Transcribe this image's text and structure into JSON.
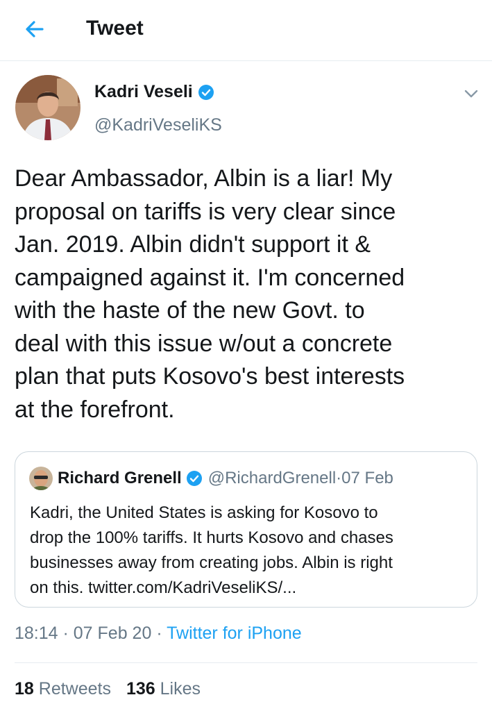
{
  "header": {
    "title": "Tweet",
    "back_icon": "arrow-left-icon",
    "accent": "#1da1f2"
  },
  "author": {
    "name": "Kadri Veseli",
    "handle": "@KadriVeseliKS",
    "verified": true
  },
  "tweet": {
    "lines": [
      "Dear Ambassador, Albin is a liar! My",
      "proposal on tariffs is very clear since",
      "Jan. 2019. Albin didn't support it &",
      "campaigned against it. I'm concerned",
      "with the haste of the new Govt. to",
      "deal with this issue w/out a concrete",
      "plan that puts Kosovo's best interests",
      "at the forefront."
    ]
  },
  "quote": {
    "name": "Richard Grenell",
    "handle": "@RichardGrenell",
    "sep": " · ",
    "date": "07 Feb",
    "verified": true,
    "lines": [
      "Kadri, the United States is asking for Kosovo to",
      "drop the 100% tariffs. It hurts Kosovo and chases",
      "businesses away from creating jobs. Albin is right",
      "on this. twitter.com/KadriVeseliKS/..."
    ]
  },
  "meta": {
    "time": "18:14",
    "sep1": " · ",
    "date": "07 Feb 20",
    "sep2": " · ",
    "source": "Twitter for iPhone"
  },
  "stats": {
    "retweets_count": "18",
    "retweets_label": "Retweets",
    "likes_count": "136",
    "likes_label": "Likes"
  },
  "colors": {
    "text": "#14171a",
    "secondary": "#657786",
    "link": "#1da1f2",
    "border": "#e6ecf0"
  }
}
